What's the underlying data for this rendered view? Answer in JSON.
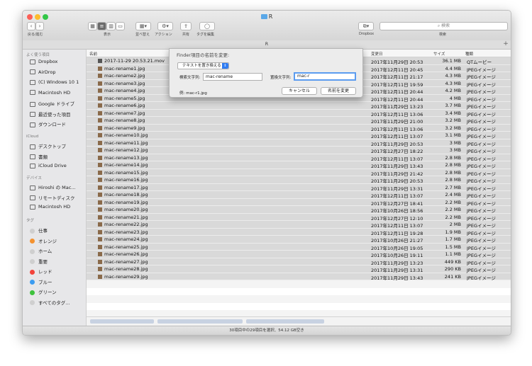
{
  "window": {
    "title": "R"
  },
  "toolbar": {
    "back_forward_label": "戻る/進む",
    "view_label": "表示",
    "arrange_label": "並べ替え",
    "action_label": "アクション",
    "share_label": "共有",
    "tags_label": "タグを編集",
    "dropbox_label": "Dropbox",
    "search_placeholder": "検索",
    "search_label": "検索"
  },
  "tab": {
    "title": "R"
  },
  "sidebar": {
    "favorites_header": "よく使う項目",
    "favorites": [
      "Dropbox",
      "AirDrop",
      "(C) Windows 10 1",
      "Macintosh HD",
      "Google ドライブ",
      "最近使った項目",
      "ダウンロード"
    ],
    "icloud_header": "iCloud",
    "icloud": [
      "デスクトップ",
      "書類",
      "iCloud Drive"
    ],
    "devices_header": "デバイス",
    "devices": [
      "Hiroshi の Mac...",
      "リモートディスク",
      "Macintosh HD"
    ],
    "tags_header": "タグ",
    "tags": [
      {
        "label": "仕事",
        "color": "#cfcfcf"
      },
      {
        "label": "オレンジ",
        "color": "#f4922f"
      },
      {
        "label": "ホーム",
        "color": "#cfcfcf"
      },
      {
        "label": "重要",
        "color": "#cfcfcf"
      },
      {
        "label": "レッド",
        "color": "#f3443b"
      },
      {
        "label": "ブルー",
        "color": "#3b9cf1"
      },
      {
        "label": "グリーン",
        "color": "#3ec23d"
      },
      {
        "label": "すべてのタグ...",
        "color": "#cfcfcf"
      }
    ]
  },
  "columns": {
    "name": "名前",
    "date": "変更日",
    "size": "サイズ",
    "kind": "種類"
  },
  "files": [
    {
      "name": "2017-11-29 20.53.21.mov",
      "date": "2017年11月29日 20:53",
      "size": "36.1 MB",
      "kind": "QTムービー"
    },
    {
      "name": "mac-rename1.jpg",
      "date": "2017年12月11日 20:45",
      "size": "4.4 MB",
      "kind": "JPEGイメージ"
    },
    {
      "name": "mac-rename2.jpg",
      "date": "2017年12月11日 21:17",
      "size": "4.3 MB",
      "kind": "JPEGイメージ"
    },
    {
      "name": "mac-rename3.jpg",
      "date": "2017年12月11日 19:59",
      "size": "4.3 MB",
      "kind": "JPEGイメージ"
    },
    {
      "name": "mac-rename4.jpg",
      "date": "2017年12月11日 20:44",
      "size": "4.2 MB",
      "kind": "JPEGイメージ"
    },
    {
      "name": "mac-rename5.jpg",
      "date": "2017年12月11日 20:44",
      "size": "4 MB",
      "kind": "JPEGイメージ"
    },
    {
      "name": "mac-rename6.jpg",
      "date": "2017年11月29日 13:23",
      "size": "3.7 MB",
      "kind": "JPEGイメージ"
    },
    {
      "name": "mac-rename7.jpg",
      "date": "2017年12月11日 13:06",
      "size": "3.4 MB",
      "kind": "JPEGイメージ"
    },
    {
      "name": "mac-rename8.jpg",
      "date": "2017年11月29日 21:00",
      "size": "3.2 MB",
      "kind": "JPEGイメージ"
    },
    {
      "name": "mac-rename9.jpg",
      "date": "2017年12月11日 13:06",
      "size": "3.2 MB",
      "kind": "JPEGイメージ"
    },
    {
      "name": "mac-rename10.jpg",
      "date": "2017年12月11日 13:07",
      "size": "3.1 MB",
      "kind": "JPEGイメージ"
    },
    {
      "name": "mac-rename11.jpg",
      "date": "2017年11月29日 20:53",
      "size": "3 MB",
      "kind": "JPEGイメージ"
    },
    {
      "name": "mac-rename12.jpg",
      "date": "2017年12月27日 18:22",
      "size": "3 MB",
      "kind": "JPEGイメージ"
    },
    {
      "name": "mac-rename13.jpg",
      "date": "2017年12月11日 13:07",
      "size": "2.8 MB",
      "kind": "JPEGイメージ"
    },
    {
      "name": "mac-rename14.jpg",
      "date": "2017年11月29日 13:43",
      "size": "2.8 MB",
      "kind": "JPEGイメージ"
    },
    {
      "name": "mac-rename15.jpg",
      "date": "2017年11月29日 21:42",
      "size": "2.8 MB",
      "kind": "JPEGイメージ"
    },
    {
      "name": "mac-rename16.jpg",
      "date": "2017年11月29日 20:53",
      "size": "2.8 MB",
      "kind": "JPEGイメージ"
    },
    {
      "name": "mac-rename17.jpg",
      "date": "2017年11月29日 13:31",
      "size": "2.7 MB",
      "kind": "JPEGイメージ"
    },
    {
      "name": "mac-rename18.jpg",
      "date": "2017年12月11日 13:07",
      "size": "2.4 MB",
      "kind": "JPEGイメージ"
    },
    {
      "name": "mac-rename19.jpg",
      "date": "2017年12月27日 18:41",
      "size": "2.2 MB",
      "kind": "JPEGイメージ"
    },
    {
      "name": "mac-rename20.jpg",
      "date": "2017年10月26日 18:56",
      "size": "2.2 MB",
      "kind": "JPEGイメージ"
    },
    {
      "name": "mac-rename21.jpg",
      "date": "2017年12月27日 12:10",
      "size": "2.2 MB",
      "kind": "JPEGイメージ"
    },
    {
      "name": "mac-rename22.jpg",
      "date": "2017年12月11日 13:07",
      "size": "2 MB",
      "kind": "JPEGイメージ"
    },
    {
      "name": "mac-rename23.jpg",
      "date": "2017年12月11日 19:28",
      "size": "1.9 MB",
      "kind": "JPEGイメージ"
    },
    {
      "name": "mac-rename24.jpg",
      "date": "2017年10月26日 21:27",
      "size": "1.7 MB",
      "kind": "JPEGイメージ"
    },
    {
      "name": "mac-rename25.jpg",
      "date": "2017年10月26日 19:05",
      "size": "1.5 MB",
      "kind": "JPEGイメージ"
    },
    {
      "name": "mac-rename26.jpg",
      "date": "2017年10月26日 19:11",
      "size": "1.1 MB",
      "kind": "JPEGイメージ"
    },
    {
      "name": "mac-rename27.jpg",
      "date": "2017年11月29日 13:23",
      "size": "449 KB",
      "kind": "JPEGイメージ"
    },
    {
      "name": "mac-rename28.jpg",
      "date": "2017年11月29日 13:31",
      "size": "290 KB",
      "kind": "JPEGイメージ"
    },
    {
      "name": "mac-rename29.jpg",
      "date": "2017年11月29日 13:43",
      "size": "241 KB",
      "kind": "JPEGイメージ"
    }
  ],
  "dialog": {
    "title": "Finder項目の名前を変更:",
    "mode": "テキストを置き換える",
    "find_label": "検索文字列:",
    "find_value": "mac-rename",
    "replace_label": "置換文字列:",
    "replace_value": "mac-r",
    "example": "例: mac-r1.jpg",
    "cancel": "キャンセル",
    "rename": "名前を変更"
  },
  "status": {
    "text": "30項目中の29項目を選択、54.12 GB空き"
  }
}
